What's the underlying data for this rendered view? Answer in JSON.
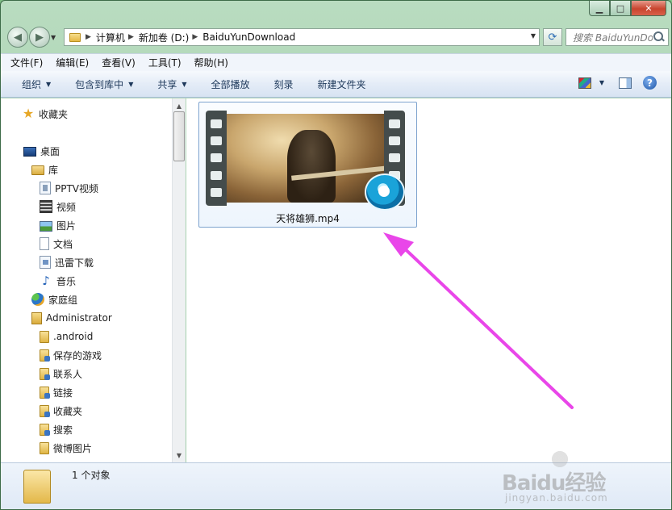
{
  "window": {
    "caption_buttons": {
      "minimize": "▁",
      "maximize": "□",
      "close": "✕"
    }
  },
  "nav": {
    "breadcrumbs": [
      "计算机",
      "新加卷 (D:)",
      "BaiduYunDownload"
    ],
    "search_placeholder": "搜索 BaiduYunDownload"
  },
  "menu": [
    "文件(F)",
    "编辑(E)",
    "查看(V)",
    "工具(T)",
    "帮助(H)"
  ],
  "toolbar": {
    "organize": "组织",
    "include_in_library": "包含到库中",
    "share": "共享",
    "play_all": "全部播放",
    "burn": "刻录",
    "new_folder": "新建文件夹"
  },
  "sidebar": {
    "favorites": "收藏夹",
    "desktop": "桌面",
    "libraries": "库",
    "library_items": [
      "PPTV视频",
      "视频",
      "图片",
      "文档",
      "迅雷下载",
      "音乐"
    ],
    "homegroup": "家庭组",
    "user": "Administrator",
    "user_items": [
      ".android",
      "保存的游戏",
      "联系人",
      "链接",
      "收藏夹",
      "搜索",
      "微博图片"
    ]
  },
  "content": {
    "files": [
      {
        "name": "天将雄狮.mp4"
      }
    ]
  },
  "status": {
    "count_text": "1 个对象"
  },
  "watermark": {
    "main": "Baidu经验",
    "sub": "jingyan.baidu.com"
  },
  "colors": {
    "arrow": "#e946e9",
    "selection_border": "#7da2ce",
    "toolbar_text": "#1e395b"
  }
}
